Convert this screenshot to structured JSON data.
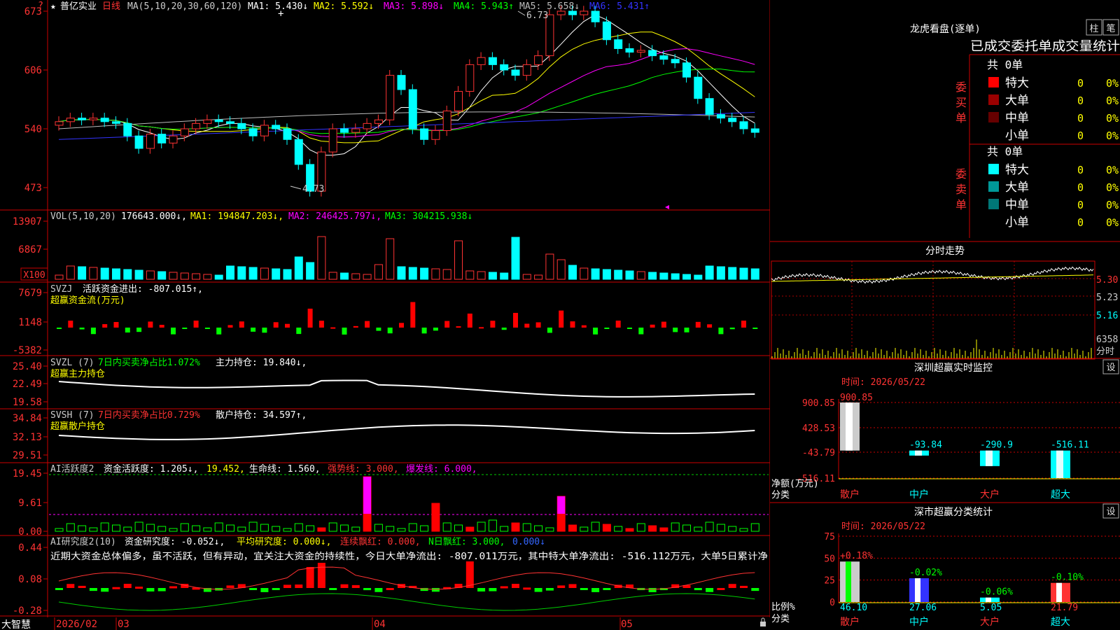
{
  "header": {
    "qmark": "?",
    "star": "★",
    "stock_name": "普亿实业",
    "period": "日线",
    "ma_label": "MA(5,10,20,30,60,120)",
    "ma": [
      {
        "label": "MA1:",
        "value": "5.430↓",
        "color": "#ffffff"
      },
      {
        "label": "MA2:",
        "value": "5.592↓",
        "color": "#ffff00"
      },
      {
        "label": "MA3:",
        "value": "5.898↓",
        "color": "#ff00ff"
      },
      {
        "label": "MA4:",
        "value": "5.943↑",
        "color": "#00ff00"
      },
      {
        "label": "MA5:",
        "value": "5.658↓",
        "color": "#bbbbbb"
      },
      {
        "label": "MA6:",
        "value": "5.431↑",
        "color": "#3333ff"
      }
    ],
    "high_mark": "6.73",
    "low_mark": "4.73"
  },
  "price_axis": [
    "673",
    "606",
    "540",
    "473"
  ],
  "vol": {
    "title": "VOL(5,10,20)",
    "value": "176643.000↓,",
    "ma1": "MA1: 194847.203↓,",
    "ma2": "MA2: 246425.797↓,",
    "ma3": "MA3: 304215.938↓",
    "axis": [
      "13907",
      "6867"
    ],
    "unit": "X100"
  },
  "svzj": {
    "title": "SVZJ",
    "desc": "活跃资金进出: -807.015↑,",
    "sub": "超赢资金流(万元)",
    "axis": [
      "7679",
      "1148",
      "-5382"
    ]
  },
  "svzl": {
    "title": "SVZL (7)",
    "desc": "7日内买卖净占比1.072%",
    "hold": "主力持仓: 19.840↓,",
    "sub": "超赢主力持仓",
    "axis": [
      "25.40",
      "22.49",
      "19.58"
    ]
  },
  "svsh": {
    "title": "SVSH (7)",
    "desc": "7日内买卖净占比0.729%",
    "hold": "散户持仓: 34.597↑,",
    "sub": "超赢散户持仓",
    "axis": [
      "34.84",
      "32.13",
      "29.51"
    ]
  },
  "ai1": {
    "title": "AI活跃度2",
    "a": "资金活跃度: 1.205↓,",
    "b": "19.452,",
    "c": "生命线: 1.560,",
    "d": "强势线: 3.000,",
    "e": "爆发线: 6.000,",
    "axis": [
      "19.45",
      "9.61",
      "0.00"
    ]
  },
  "ai2": {
    "title": "AI研究度2(10)",
    "a": "资金研究度: -0.052↓,",
    "b": "平均研究度: 0.000↓,",
    "c": "连续飘红: 0.000,",
    "d": "N日飘红: 3.000,",
    "e": "0.000↓",
    "text": "近期大资金总体偏多，虽不活跃，但有异动，宜关注大资金的持续性，今日大单净流出: -807.011万元，其中特大单净流出: -516.112万元，大单5日累计净",
    "axis": [
      "0.44",
      "0.08",
      "-0.28"
    ]
  },
  "date_axis": {
    "brand": "大智慧",
    "labels": [
      "2026/02",
      "03",
      "04",
      "05"
    ]
  },
  "longhu": {
    "title": "龙虎看盘(逐单)",
    "btn1": "柱",
    "btn2": "笔",
    "subtitle": "已成交委托单成交量统计",
    "buy_label": "委买单",
    "sell_label": "委卖单",
    "buy_total": "共 0单",
    "sell_total": "共 0单",
    "buy_rows": [
      {
        "name": "特大",
        "count": "0",
        "pct": "0%",
        "color": "#ff0000"
      },
      {
        "name": "大单",
        "count": "0",
        "pct": "0%",
        "color": "#990000"
      },
      {
        "name": "中单",
        "count": "0",
        "pct": "0%",
        "color": "#660000"
      },
      {
        "name": "小单",
        "count": "0",
        "pct": "0%",
        "color": ""
      }
    ],
    "sell_rows": [
      {
        "name": "特大",
        "count": "0",
        "pct": "0%",
        "color": "#00ffff"
      },
      {
        "name": "大单",
        "count": "0",
        "pct": "0%",
        "color": "#009999"
      },
      {
        "name": "中单",
        "count": "0",
        "pct": "0%",
        "color": "#007777"
      },
      {
        "name": "小单",
        "count": "0",
        "pct": "0%",
        "color": ""
      }
    ]
  },
  "fenshi": {
    "title": "分时走势",
    "axis": [
      "5.30",
      "5.23",
      "5.16"
    ],
    "vol_label": "6358",
    "vol_unit": "分时"
  },
  "realtime": {
    "title": "深圳超赢实时监控",
    "btn": "设",
    "time": "时间: 2026/05/22",
    "axis": [
      "900.85",
      "428.53",
      "-43.79",
      "-516.11"
    ],
    "ylabel": "净额(万元)",
    "xlabel": "分类",
    "categories": [
      "散户",
      "中户",
      "大户",
      "超大"
    ],
    "values": [
      900.85,
      -93.84,
      -290.9,
      -516.11
    ],
    "value_labels": [
      "900.85",
      "-93.84",
      "-290.9",
      "-516.11"
    ]
  },
  "classify": {
    "title": "深市超赢分类统计",
    "btn": "设",
    "time": "时间: 2026/05/22",
    "axis": [
      "75",
      "50",
      "25",
      "0"
    ],
    "ylabel": "比例%",
    "xlabel": "分类",
    "categories": [
      "散户",
      "中户",
      "大户",
      "超大"
    ],
    "values": [
      46.1,
      27.06,
      5.05,
      21.79
    ],
    "value_labels": [
      "46.10",
      "27.06",
      "5.05",
      "21.79"
    ],
    "changes": [
      "+0.18%",
      "-0.02%",
      "-0.06%",
      "-0.10%"
    ]
  },
  "chart_data": {
    "type": "table",
    "title": "深圳超赢实时监控",
    "categories": [
      "散户",
      "中户",
      "大户",
      "超大"
    ],
    "series": [
      {
        "name": "净额(万元)",
        "values": [
          900.85,
          -93.84,
          -290.9,
          -516.11
        ]
      },
      {
        "name": "比例%",
        "values": [
          46.1,
          27.06,
          5.05,
          21.79
        ]
      }
    ]
  }
}
